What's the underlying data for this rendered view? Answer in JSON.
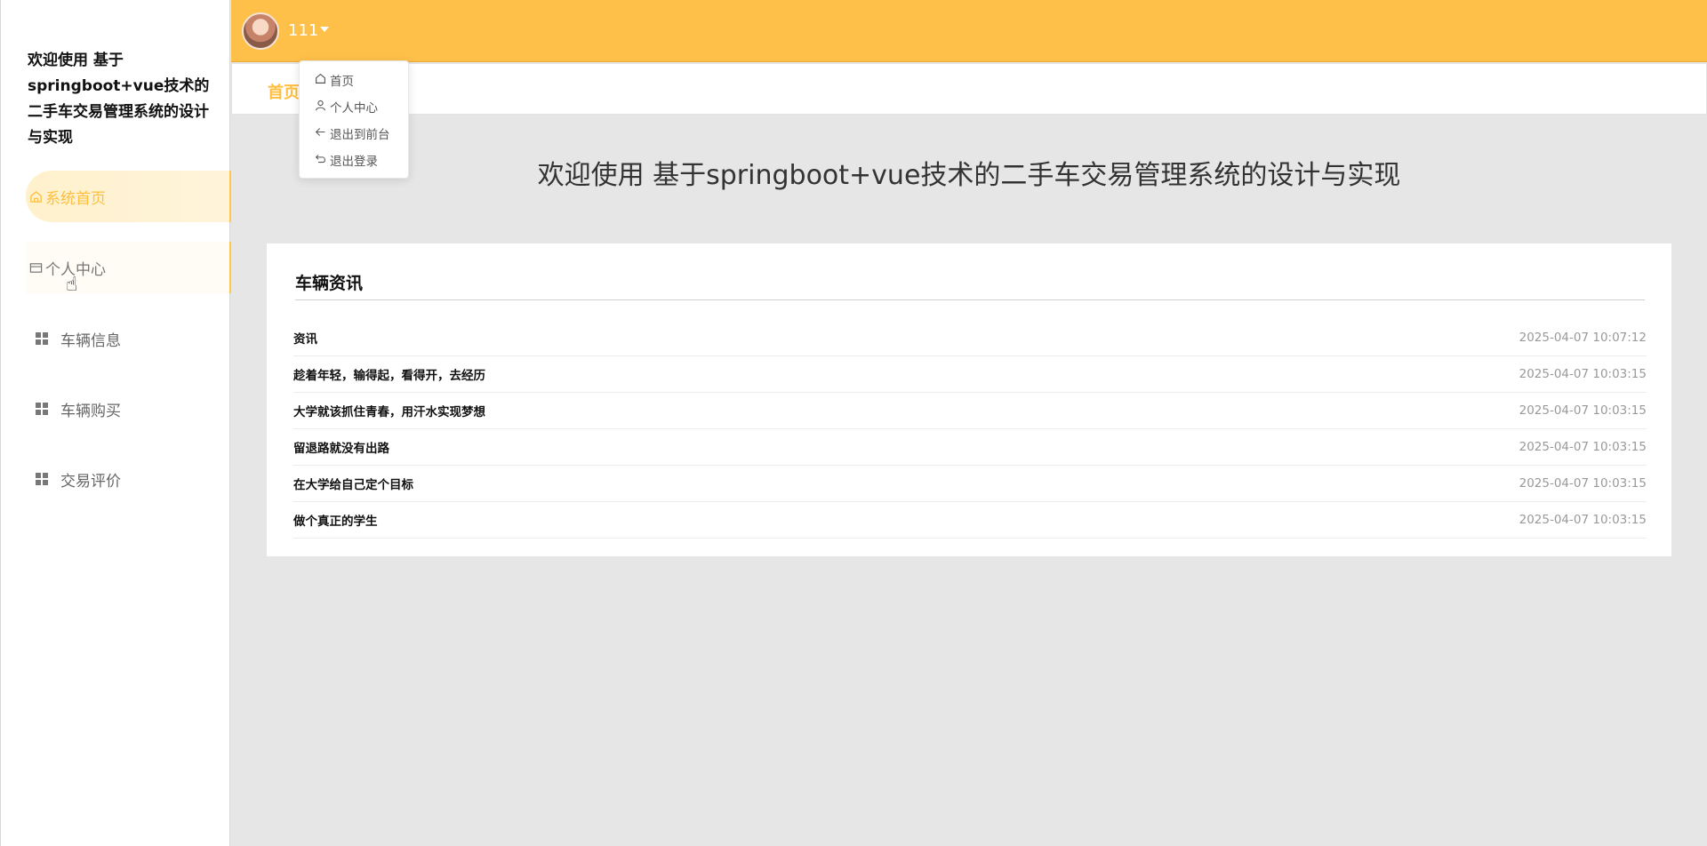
{
  "site": {
    "title": "欢迎使用 基于springboot+vue技术的二手车交易管理系统的设计与实现"
  },
  "sidebar": {
    "items": [
      {
        "label": "系统首页",
        "icon": "home-icon"
      },
      {
        "label": "个人中心",
        "icon": "card-icon"
      },
      {
        "label": "车辆信息",
        "icon": "grid-icon"
      },
      {
        "label": "车辆购买",
        "icon": "grid-icon"
      },
      {
        "label": "交易评价",
        "icon": "grid-icon"
      }
    ]
  },
  "topbar": {
    "username": "111"
  },
  "tabs": {
    "home": "首页"
  },
  "user_menu": {
    "items": [
      {
        "label": "首页",
        "icon": "home-icon"
      },
      {
        "label": "个人中心",
        "icon": "user-icon"
      },
      {
        "label": "退出到前台",
        "icon": "back-icon"
      },
      {
        "label": "退出登录",
        "icon": "logout-icon"
      }
    ]
  },
  "main": {
    "welcome": "欢迎使用 基于springboot+vue技术的二手车交易管理系统的设计与实现",
    "news": {
      "title": "车辆资讯",
      "rows": [
        {
          "title": "资讯",
          "time": "2025-04-07 10:07:12"
        },
        {
          "title": "趁着年轻，输得起，看得开，去经历",
          "time": "2025-04-07 10:03:15"
        },
        {
          "title": "大学就该抓住青春，用汗水实现梦想",
          "time": "2025-04-07 10:03:15"
        },
        {
          "title": "留退路就没有出路",
          "time": "2025-04-07 10:03:15"
        },
        {
          "title": "在大学给自己定个目标",
          "time": "2025-04-07 10:03:15"
        },
        {
          "title": "做个真正的学生",
          "time": "2025-04-07 10:03:15"
        }
      ]
    }
  },
  "colors": {
    "accent": "#ffc04a",
    "active_text": "#ffbe3d"
  }
}
